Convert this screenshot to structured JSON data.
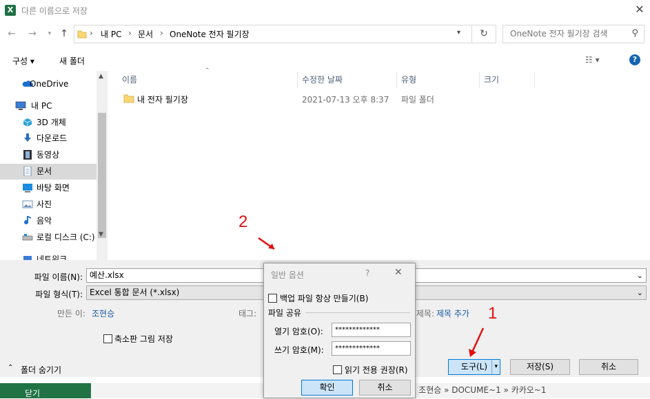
{
  "window": {
    "title": "다른 이름으로 저장",
    "app_icon": "X"
  },
  "address": {
    "crumbs": [
      "내 PC",
      "문서",
      "OneNote 전자 필기장"
    ],
    "search_placeholder": "OneNote 전자 필기장 검색"
  },
  "toolbar": {
    "organize": "구성 ▾",
    "new_folder": "새 폴더"
  },
  "nav": {
    "items": [
      {
        "label": "OneDrive",
        "icon": "cloud-icon",
        "color": "#1c6fd1"
      },
      {
        "label": "내 PC",
        "icon": "computer-icon",
        "color": "#3a7bd5"
      },
      {
        "label": "3D 개체",
        "icon": "cube-icon",
        "color": "#2aa2d9"
      },
      {
        "label": "다운로드",
        "icon": "download-arrow-icon",
        "color": "#2b6cc4"
      },
      {
        "label": "동영상",
        "icon": "film-icon",
        "color": "#333333"
      },
      {
        "label": "문서",
        "icon": "document-icon",
        "color": "#6b8fb5"
      },
      {
        "label": "바탕 화면",
        "icon": "desktop-icon",
        "color": "#1c8be0"
      },
      {
        "label": "사진",
        "icon": "picture-icon",
        "color": "#6b8fb5"
      },
      {
        "label": "음악",
        "icon": "music-note-icon",
        "color": "#1f6fd0"
      },
      {
        "label": "로컬 디스크 (C:)",
        "icon": "drive-icon",
        "color": "#555555"
      },
      {
        "label": "네트워크",
        "icon": "network-icon",
        "color": "#3a7bd5"
      }
    ],
    "selected": "문서"
  },
  "files": {
    "columns": [
      "이름",
      "수정한 날짜",
      "유형",
      "크기"
    ],
    "rows": [
      {
        "name": "내 전자 필기장",
        "modified": "2021-07-13 오후 8:37",
        "type": "파일 폴더",
        "size": ""
      }
    ]
  },
  "form": {
    "filename_label": "파일 이름(N):",
    "filename_value": "예산.xlsx",
    "filetype_label": "파일 형식(T):",
    "filetype_value": "Excel 통합 문서 (*.xlsx)",
    "author_label": "만든 이:",
    "author_value": "조현승",
    "tags_label": "태그:",
    "title_label": "제목:",
    "title_value": "제목 추가",
    "thumbnail_label": "축소판 그림 저장",
    "hide_folders": "폴더 숨기기",
    "tools_button": "도구(L)",
    "save_button": "저장(S)",
    "cancel_button": "취소"
  },
  "status": {
    "path_text": "» 조현승 » DOCUME~1 » 카카오~1",
    "close_label": "닫기"
  },
  "dialog": {
    "title": "일반 옵션",
    "help": "?",
    "backup_label": "백업 파일 항상 만들기(B)",
    "sharing_header": "파일 공유",
    "open_pw_label": "열기 암호(O):",
    "open_pw_value": "*************",
    "write_pw_label": "쓰기 암호(M):",
    "write_pw_value": "*************",
    "readonly_label": "읽기 전용 권장(R)",
    "ok_button": "확인",
    "cancel_button": "취소"
  },
  "annotations": {
    "marker_1": "1",
    "marker_2": "2"
  }
}
